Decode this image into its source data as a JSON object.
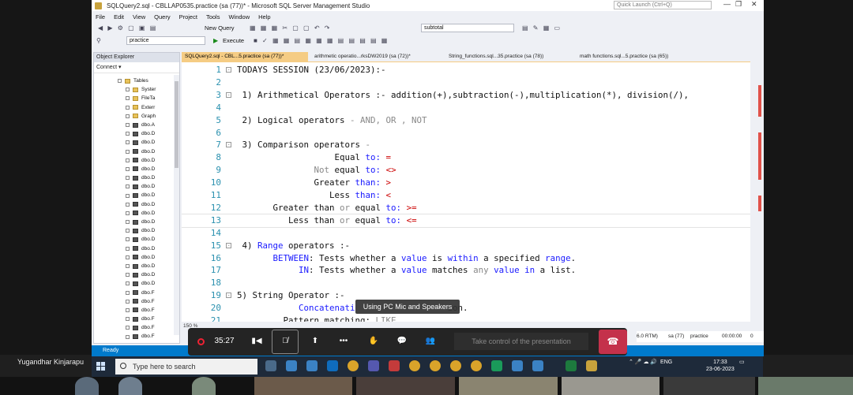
{
  "window": {
    "title": "SQLQuery2.sql - CBLLAP0535.practice (sa (77))* - Microsoft SQL Server Management Studio",
    "quick_launch_placeholder": "Quick Launch (Ctrl+Q)"
  },
  "menu": [
    "File",
    "Edit",
    "View",
    "Query",
    "Project",
    "Tools",
    "Window",
    "Help"
  ],
  "toolbar": {
    "new_query_label": "New Query",
    "find_combo_value": "subtotal",
    "database_combo_value": "practice",
    "execute_label": "Execute"
  },
  "object_explorer": {
    "title": "Object Explorer",
    "connect_label": "Connect ▾",
    "tree": [
      {
        "label": "Tables",
        "type": "folder"
      },
      {
        "label": "Syster",
        "type": "folder"
      },
      {
        "label": "FileTa",
        "type": "folder"
      },
      {
        "label": "Exterr",
        "type": "folder"
      },
      {
        "label": "Graph",
        "type": "folder"
      },
      {
        "label": "dbo.A",
        "type": "table"
      },
      {
        "label": "dbo.D",
        "type": "table"
      },
      {
        "label": "dbo.D",
        "type": "table"
      },
      {
        "label": "dbo.D",
        "type": "table"
      },
      {
        "label": "dbo.D",
        "type": "table"
      },
      {
        "label": "dbo.D",
        "type": "table"
      },
      {
        "label": "dbo.D",
        "type": "table"
      },
      {
        "label": "dbo.D",
        "type": "table"
      },
      {
        "label": "dbo.D",
        "type": "table"
      },
      {
        "label": "dbo.D",
        "type": "table"
      },
      {
        "label": "dbo.D",
        "type": "table"
      },
      {
        "label": "dbo.D",
        "type": "table"
      },
      {
        "label": "dbo.D",
        "type": "table"
      },
      {
        "label": "dbo.D",
        "type": "table"
      },
      {
        "label": "dbo.D",
        "type": "table"
      },
      {
        "label": "dbo.D",
        "type": "table"
      },
      {
        "label": "dbo.D",
        "type": "table"
      },
      {
        "label": "dbo.D",
        "type": "table"
      },
      {
        "label": "dbo.D",
        "type": "table"
      },
      {
        "label": "dbo.F",
        "type": "table"
      },
      {
        "label": "dbo.F",
        "type": "table"
      },
      {
        "label": "dbo.F",
        "type": "table"
      },
      {
        "label": "dbo.F",
        "type": "table"
      },
      {
        "label": "dbo.F",
        "type": "table"
      },
      {
        "label": "dbo.F",
        "type": "table"
      }
    ]
  },
  "tabs": [
    {
      "label": "SQLQuery2.sql - CBL...5.practice (sa (77))*",
      "active": true
    },
    {
      "label": "arithmetic operatio...rksDW2019 (sa (72))*",
      "active": false
    },
    {
      "label": "String_functions.sql...35.practice (sa (78))",
      "active": false
    },
    {
      "label": "math functions.sql...5.practice (sa (65))",
      "active": false
    }
  ],
  "editor": {
    "zoom": "150 %",
    "lines": [
      {
        "n": "1",
        "fold": "-",
        "parts": [
          {
            "t": "TODAYS SESSION (23/06/2023):-",
            "c": ""
          }
        ]
      },
      {
        "n": "2",
        "fold": "",
        "parts": []
      },
      {
        "n": "3",
        "fold": "-",
        "parts": [
          {
            "t": " 1) Arithmetical Operators :- addition(+),subtraction(-),multiplication(*), division(/),",
            "c": ""
          }
        ]
      },
      {
        "n": "4",
        "fold": "",
        "parts": []
      },
      {
        "n": "5",
        "fold": "",
        "parts": [
          {
            "t": " 2) Logical operators ",
            "c": ""
          },
          {
            "t": "- AND, OR , NOT",
            "c": "gray"
          }
        ]
      },
      {
        "n": "6",
        "fold": "",
        "parts": []
      },
      {
        "n": "7",
        "fold": "-",
        "parts": [
          {
            "t": " 3) Comparison operators ",
            "c": ""
          },
          {
            "t": "-",
            "c": "gray"
          }
        ]
      },
      {
        "n": "8",
        "fold": "",
        "parts": [
          {
            "t": "                   Equal ",
            "c": ""
          },
          {
            "t": "to:",
            "c": "kw"
          },
          {
            "t": " ",
            "c": ""
          },
          {
            "t": "=",
            "c": "red"
          }
        ]
      },
      {
        "n": "9",
        "fold": "",
        "parts": [
          {
            "t": "               Not ",
            "c": "gray"
          },
          {
            "t": "equal ",
            "c": ""
          },
          {
            "t": "to:",
            "c": "kw"
          },
          {
            "t": " ",
            "c": ""
          },
          {
            "t": "<>",
            "c": "red"
          }
        ]
      },
      {
        "n": "10",
        "fold": "",
        "parts": [
          {
            "t": "               Greater ",
            "c": ""
          },
          {
            "t": "than:",
            "c": "kw"
          },
          {
            "t": " ",
            "c": ""
          },
          {
            "t": ">",
            "c": "red"
          }
        ]
      },
      {
        "n": "11",
        "fold": "",
        "parts": [
          {
            "t": "                  Less ",
            "c": ""
          },
          {
            "t": "than:",
            "c": "kw"
          },
          {
            "t": " ",
            "c": ""
          },
          {
            "t": "<",
            "c": "red"
          }
        ]
      },
      {
        "n": "12",
        "fold": "",
        "parts": [
          {
            "t": "       Greater than ",
            "c": ""
          },
          {
            "t": "or",
            "c": "gray"
          },
          {
            "t": " equal ",
            "c": ""
          },
          {
            "t": "to:",
            "c": "kw"
          },
          {
            "t": " ",
            "c": ""
          },
          {
            "t": ">=",
            "c": "red"
          }
        ]
      },
      {
        "n": "13",
        "fold": "",
        "parts": [
          {
            "t": "          Less than ",
            "c": ""
          },
          {
            "t": "or",
            "c": "gray"
          },
          {
            "t": " equal ",
            "c": ""
          },
          {
            "t": "to:",
            "c": "kw"
          },
          {
            "t": " ",
            "c": ""
          },
          {
            "t": "<=",
            "c": "red"
          }
        ]
      },
      {
        "n": "14",
        "fold": "",
        "parts": []
      },
      {
        "n": "15",
        "fold": "-",
        "parts": [
          {
            "t": " 4) ",
            "c": ""
          },
          {
            "t": "Range",
            "c": "kw"
          },
          {
            "t": " operators :-",
            "c": ""
          }
        ]
      },
      {
        "n": "16",
        "fold": "",
        "parts": [
          {
            "t": "       BETWEEN",
            "c": "kw"
          },
          {
            "t": ": Tests whether a ",
            "c": ""
          },
          {
            "t": "value",
            "c": "kw"
          },
          {
            "t": " is ",
            "c": ""
          },
          {
            "t": "within",
            "c": "kw"
          },
          {
            "t": " a specified ",
            "c": ""
          },
          {
            "t": "range",
            "c": "kw"
          },
          {
            "t": ".",
            "c": ""
          }
        ]
      },
      {
        "n": "17",
        "fold": "",
        "parts": [
          {
            "t": "            IN",
            "c": "kw"
          },
          {
            "t": ": Tests whether a ",
            "c": ""
          },
          {
            "t": "value",
            "c": "kw"
          },
          {
            "t": " matches ",
            "c": ""
          },
          {
            "t": "any",
            "c": "gray"
          },
          {
            "t": " ",
            "c": ""
          },
          {
            "t": "value",
            "c": "kw"
          },
          {
            "t": " ",
            "c": ""
          },
          {
            "t": "in",
            "c": "kw"
          },
          {
            "t": " a list.",
            "c": ""
          }
        ]
      },
      {
        "n": "18",
        "fold": "",
        "parts": []
      },
      {
        "n": "19",
        "fold": "-",
        "parts": [
          {
            "t": "5) String Operator :-",
            "c": ""
          }
        ]
      },
      {
        "n": "20",
        "fold": "",
        "parts": [
          {
            "t": "            Concatenati",
            "c": "kw"
          },
          {
            "t": "                  ion.",
            "c": ""
          }
        ]
      },
      {
        "n": "21",
        "fold": "",
        "parts": [
          {
            "t": "         Pattern matching: ",
            "c": ""
          },
          {
            "t": "LIKE",
            "c": "gray"
          }
        ]
      }
    ]
  },
  "status": {
    "ready": "Ready",
    "right": [
      "6.0 RTM)",
      "sa (77)",
      "practice",
      "00:00:00",
      "0 rows"
    ]
  },
  "meeting": {
    "presenter_name": "Yugandhar Kinjarapu",
    "toast": "Using PC Mic and Speakers",
    "timer": "35:27",
    "take_control": "Take control of the presentation",
    "colors": {
      "hangup": "#c4314b",
      "status": "#007acc"
    }
  },
  "taskbar": {
    "search_placeholder": "Type here to search",
    "lang": "ENG",
    "time": "17:33",
    "date": "23-06-2023"
  }
}
